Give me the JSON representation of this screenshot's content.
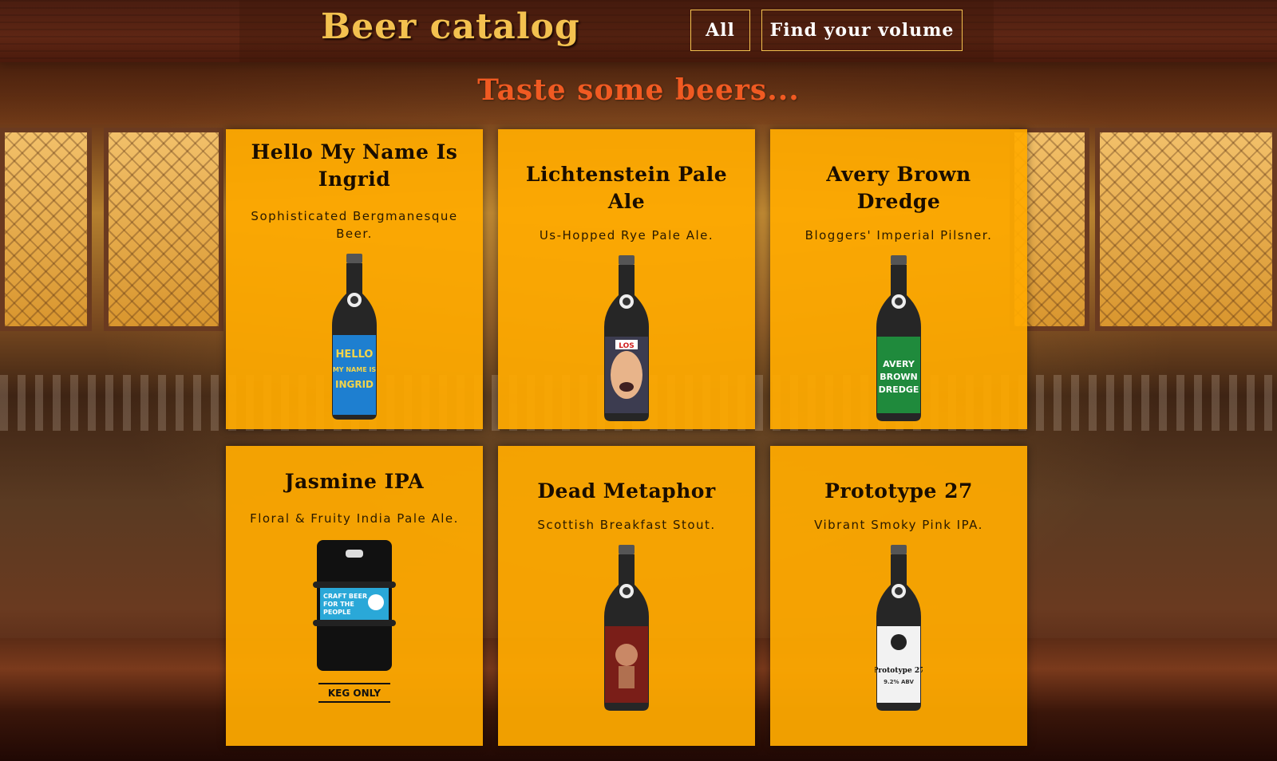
{
  "header": {
    "brand": "Beer catalog",
    "nav": [
      {
        "label": "All"
      },
      {
        "label": "Find your volume"
      }
    ]
  },
  "tagline": "Taste some beers...",
  "beers": [
    {
      "name": "Hello My Name Is Ingrid",
      "tagline": "Sophisticated Bergmanesque Beer.",
      "label_color": "#1e7fd0",
      "label_text": "HELLO MY NAME IS INGRID"
    },
    {
      "name": "Lichtenstein Pale Ale",
      "tagline": "Us-Hopped Rye Pale Ale.",
      "label_color": "#3c3c50",
      "label_text": "LOS"
    },
    {
      "name": "Avery Brown Dredge",
      "tagline": "Bloggers' Imperial Pilsner.",
      "label_color": "#1f8a3c",
      "label_text": "AVERY BROWN DREDGE"
    },
    {
      "name": "Jasmine IPA",
      "tagline": "Floral & Fruity India Pale Ale.",
      "keg_label": "CRAFT BEER FOR THE PEOPLE",
      "keg_note": "KEG ONLY"
    },
    {
      "name": "Dead Metaphor",
      "tagline": "Scottish Breakfast Stout.",
      "label_color": "#7a1e18"
    },
    {
      "name": "Prototype 27",
      "tagline": "Vibrant Smoky Pink IPA.",
      "label_color": "#f2f2f2",
      "label_text": "Prototype 27",
      "label_abv": "9.2% ABV"
    }
  ],
  "colors": {
    "brand": "#f3c14f",
    "tagline": "#f05a22",
    "card": "#ffaa00"
  }
}
